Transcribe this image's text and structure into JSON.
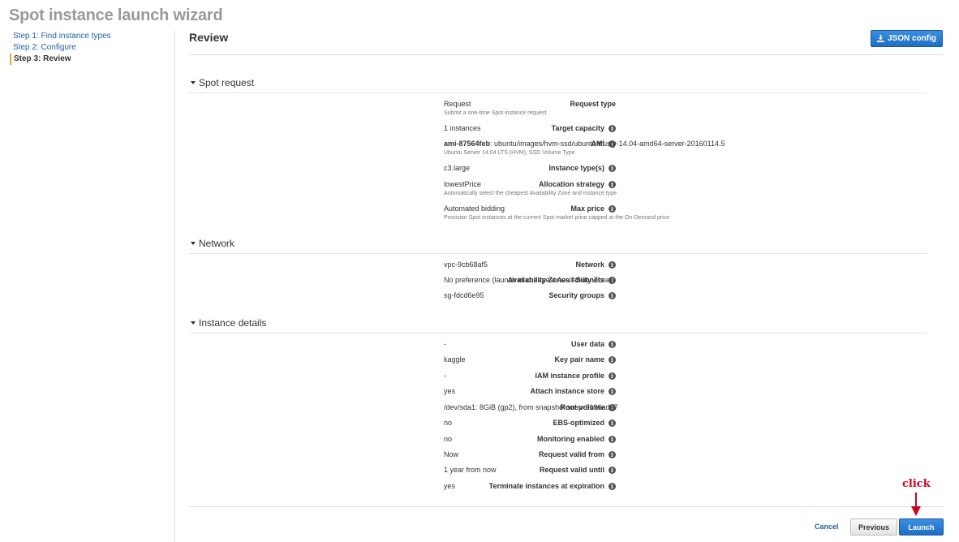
{
  "wizard": {
    "title": "Spot instance launch wizard",
    "steps": [
      {
        "label": "Step 1: Find instance types"
      },
      {
        "label": "Step 2: Configure"
      },
      {
        "label": "Step 3: Review"
      }
    ]
  },
  "review": {
    "title": "Review",
    "json_button": "JSON config"
  },
  "sections": [
    {
      "title": "Spot request",
      "rows": [
        {
          "label": "Request type",
          "value": "Request",
          "sub": "Submit a one-time Spot instance request",
          "info": false
        },
        {
          "label": "Target capacity",
          "value": "1 instances",
          "info": true
        },
        {
          "label": "AMI",
          "value_bold": "ami-87564feb",
          "value": ": ubuntu/images/hvm-ssd/ubuntu-trusty-14.04-amd64-server-20160114.5",
          "sub": "Ubuntu Server 14.04 LTS (HVM), SSD Volume Type",
          "info": true
        },
        {
          "label": "Instance type(s)",
          "value": "c3.large",
          "info": true
        },
        {
          "label": "Allocation strategy",
          "value": "lowestPrice",
          "sub": "Automatically select the cheapest Availability Zone and instance type",
          "info": true
        },
        {
          "label": "Max price",
          "value": "Automated bidding",
          "sub": "Provision Spot instances at the current Spot market price capped at the On-Demand price",
          "info": true
        }
      ]
    },
    {
      "title": "Network",
      "rows": [
        {
          "label": "Network",
          "value": "vpc-9cb68af5",
          "info": true
        },
        {
          "label": "Availability Zones / Subnets",
          "value": "No preference (launch in cheapest Availability Zone)",
          "info": true
        },
        {
          "label": "Security groups",
          "value": "sg-fdcd6e95",
          "info": true
        }
      ]
    },
    {
      "title": "Instance details",
      "rows": [
        {
          "label": "User data",
          "value": "-",
          "info": true
        },
        {
          "label": "Key pair name",
          "value": "kaggle",
          "info": true
        },
        {
          "label": "IAM instance profile",
          "value": "-",
          "info": true
        },
        {
          "label": "Attach instance store",
          "value": "yes",
          "info": true
        },
        {
          "label": "Root volume",
          "value": "/dev/sda1: 8GiB (gp2), from snapshot snap-9196ada7",
          "info": true
        },
        {
          "label": "EBS-optimized",
          "value": "no",
          "info": true
        },
        {
          "label": "Monitoring enabled",
          "value": "no",
          "info": true
        },
        {
          "label": "Request valid from",
          "value": "Now",
          "info": true
        },
        {
          "label": "Request valid until",
          "value": "1 year from now",
          "info": true
        },
        {
          "label": "Terminate instances at expiration",
          "value": "yes",
          "info": true
        }
      ]
    }
  ],
  "footer": {
    "cancel": "Cancel",
    "previous": "Previous",
    "launch": "Launch"
  },
  "annotation": {
    "text": "click",
    "color": "#d0021b"
  },
  "colors": {
    "primary_button": "#1f6fc5",
    "link": "#1f5ea8",
    "active_step_marker": "#e8a33c"
  },
  "icons": {
    "json_button": "download-icon",
    "section_toggle": "caret-down-icon",
    "field_help": "info-icon",
    "annotation": "red-arrow-icon"
  }
}
